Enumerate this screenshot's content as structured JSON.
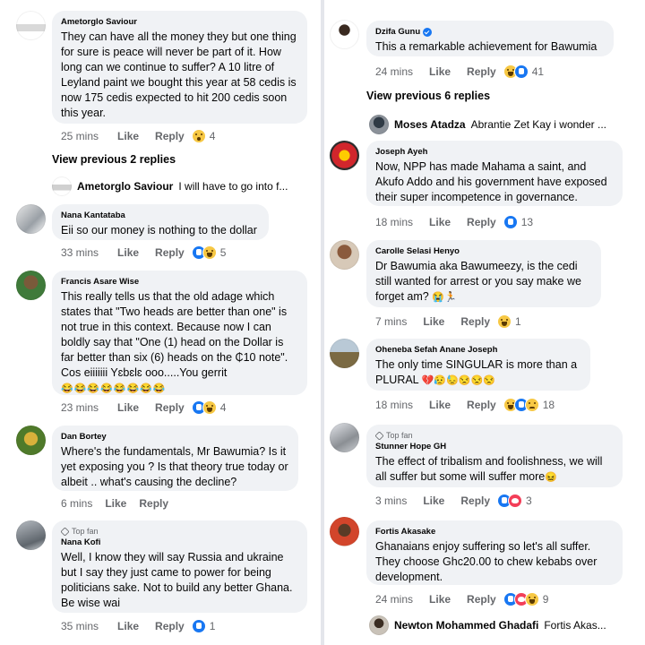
{
  "common": {
    "like": "Like",
    "reply": "Reply"
  },
  "left": {
    "c1": {
      "name": "Ametorglo Saviour",
      "text": "They can have all the money they but one thing for sure is peace will never be part of it. How long can we continue to suffer? A 10 litre of Leyland paint we bought this year at 58 cedis is now 175 cedis expected to hit 200 cedis soon this year.",
      "time": "25 mins",
      "count": "4"
    },
    "view_replies": "View previous 2 replies",
    "r1": {
      "name": "Ametorglo Saviour",
      "text": "I will have to go into f..."
    },
    "c2": {
      "name": "Nana Kantataba",
      "text": "Eii so our money is nothing to the dollar",
      "time": "33 mins",
      "count": "5"
    },
    "c3": {
      "name": "Francis Asare Wise",
      "text": "This really tells us that the old adage which states that \"Two heads are better than one\" is not true in this context. Because now I can boldly say that \"One (1) head on the Dollar is far better than six (6) heads on the ₵10 note\". Cos eiiiiiii Yɛbɛlɛ ooo.....You gerrit",
      "emojis": "😂😂😂😂😂😂😂😂",
      "time": "23 mins",
      "count": "4"
    },
    "c4": {
      "name": "Dan Bortey",
      "text": "Where's the fundamentals, Mr Bawumia? Is it yet exposing you ? Is that theory true today or albeit .. what's causing the decline?",
      "time": "6 mins"
    },
    "c5": {
      "badge": "Top fan",
      "name": "Nana Kofi",
      "text": "Well, I know they will say Russia and ukraine but I say they just came to power for being politicians sake. Not to build any better Ghana. Be wise wai",
      "time": "35 mins",
      "count": "1"
    }
  },
  "right": {
    "c1": {
      "name": "Dzifa Gunu",
      "text": "This a remarkable achievement for Bawumia",
      "time": "24 mins",
      "count": "41"
    },
    "view_replies": "View previous 6 replies",
    "r1": {
      "name": "Moses Atadza",
      "text": "Abrantie Zet Kay i wonder ..."
    },
    "c2": {
      "name": "Joseph Ayeh",
      "text": "Now, NPP has made Mahama a saint, and Akufo Addo and his government have exposed their super incompetence in governance.",
      "time": "18 mins",
      "count": "13"
    },
    "c3": {
      "name": "Carolle Selasi Henyo",
      "text": "Dr Bawumia aka Bawumeezy, is the cedi still wanted for arrest or you say make we forget am?",
      "emojis": "😭🏃",
      "time": "7 mins",
      "count": "1"
    },
    "c4": {
      "name": "Oheneba Sefah Anane Joseph",
      "text": "The only time SINGULAR is more than a PLURAL",
      "emojis": "💔😥😓😒😒😒",
      "time": "18 mins",
      "count": "18"
    },
    "c5": {
      "badge": "Top fan",
      "name": "Stunner Hope GH",
      "text": "The effect of tribalism and foolishness, we will all suffer but some will suffer more",
      "emojis": "😖",
      "time": "3 mins",
      "count": "3"
    },
    "c6": {
      "name": "Fortis Akasake",
      "text": "Ghanaians enjoy suffering so let's all suffer. They choose Ghc20.00 to chew kebabs over development.",
      "time": "24 mins",
      "count": "9"
    },
    "r2": {
      "name": "Newton Mohammed Ghadafi",
      "text": "Fortis Akas..."
    }
  }
}
